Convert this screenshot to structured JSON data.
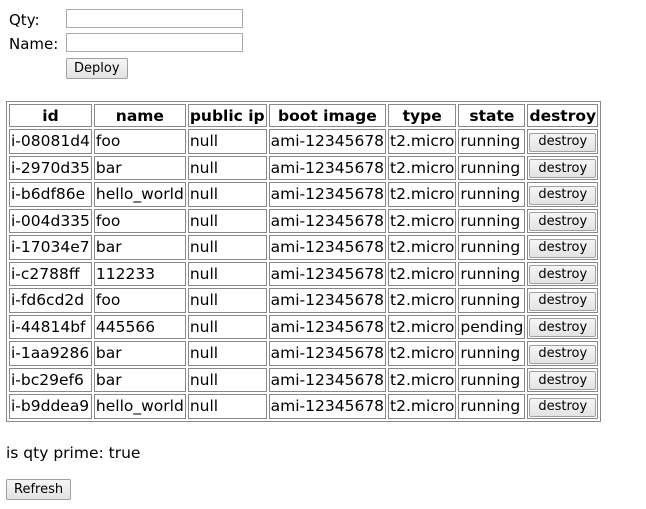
{
  "form": {
    "qty_label": "Qty:",
    "qty_value": "",
    "name_label": "Name:",
    "name_value": "",
    "deploy_label": "Deploy"
  },
  "table": {
    "headers": [
      "id",
      "name",
      "public ip",
      "boot image",
      "type",
      "state",
      "destroy"
    ],
    "rows": [
      {
        "id": "i-08081d4",
        "name": "foo",
        "public_ip": "null",
        "boot_image": "ami-12345678",
        "type": "t2.micro",
        "state": "running",
        "action": "destroy"
      },
      {
        "id": "i-2970d35",
        "name": "bar",
        "public_ip": "null",
        "boot_image": "ami-12345678",
        "type": "t2.micro",
        "state": "running",
        "action": "destroy"
      },
      {
        "id": "i-b6df86e",
        "name": "hello_world",
        "public_ip": "null",
        "boot_image": "ami-12345678",
        "type": "t2.micro",
        "state": "running",
        "action": "destroy"
      },
      {
        "id": "i-004d335",
        "name": "foo",
        "public_ip": "null",
        "boot_image": "ami-12345678",
        "type": "t2.micro",
        "state": "running",
        "action": "destroy"
      },
      {
        "id": "i-17034e7",
        "name": "bar",
        "public_ip": "null",
        "boot_image": "ami-12345678",
        "type": "t2.micro",
        "state": "running",
        "action": "destroy"
      },
      {
        "id": "i-c2788ff",
        "name": "112233",
        "public_ip": "null",
        "boot_image": "ami-12345678",
        "type": "t2.micro",
        "state": "running",
        "action": "destroy"
      },
      {
        "id": "i-fd6cd2d",
        "name": "foo",
        "public_ip": "null",
        "boot_image": "ami-12345678",
        "type": "t2.micro",
        "state": "running",
        "action": "destroy"
      },
      {
        "id": "i-44814bf",
        "name": "445566",
        "public_ip": "null",
        "boot_image": "ami-12345678",
        "type": "t2.micro",
        "state": "pending",
        "action": "destroy"
      },
      {
        "id": "i-1aa9286",
        "name": "bar",
        "public_ip": "null",
        "boot_image": "ami-12345678",
        "type": "t2.micro",
        "state": "running",
        "action": "destroy"
      },
      {
        "id": "i-bc29ef6",
        "name": "bar",
        "public_ip": "null",
        "boot_image": "ami-12345678",
        "type": "t2.micro",
        "state": "running",
        "action": "destroy"
      },
      {
        "id": "i-b9ddea9",
        "name": "hello_world",
        "public_ip": "null",
        "boot_image": "ami-12345678",
        "type": "t2.micro",
        "state": "running",
        "action": "destroy"
      }
    ]
  },
  "status": {
    "prime_text": "is qty prime: true"
  },
  "refresh_label": "Refresh"
}
